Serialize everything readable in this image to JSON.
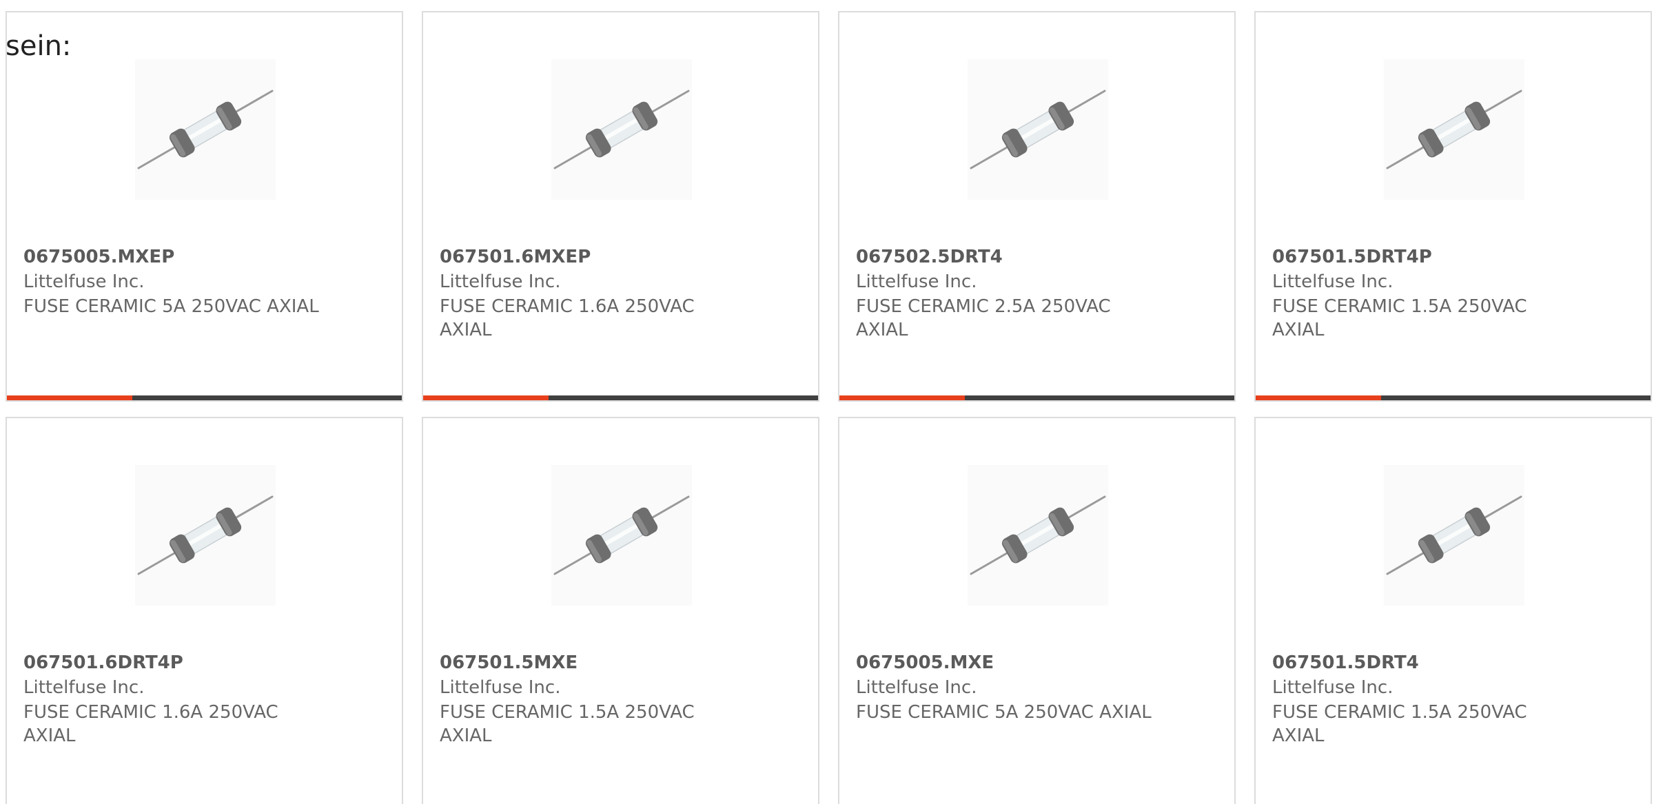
{
  "intro_text": "sein:",
  "colors": {
    "accent": "#e8401c",
    "bar": "#404040",
    "card_border": "#dcdcdc",
    "text": "#666666"
  },
  "products": [
    {
      "part": "0675005.MXEP",
      "manufacturer": "Littelfuse Inc.",
      "description": "FUSE CERAMIC 5A 250VAC AXIAL",
      "image_icon": "axial-fuse-image"
    },
    {
      "part": "067501.6MXEP",
      "manufacturer": "Littelfuse Inc.",
      "description": "FUSE CERAMIC 1.6A 250VAC AXIAL",
      "image_icon": "axial-fuse-image"
    },
    {
      "part": "067502.5DRT4",
      "manufacturer": "Littelfuse Inc.",
      "description": "FUSE CERAMIC 2.5A 250VAC AXIAL",
      "image_icon": "axial-fuse-image"
    },
    {
      "part": "067501.5DRT4P",
      "manufacturer": "Littelfuse Inc.",
      "description": "FUSE CERAMIC 1.5A 250VAC AXIAL",
      "image_icon": "axial-fuse-image"
    },
    {
      "part": "067501.6DRT4P",
      "manufacturer": "Littelfuse Inc.",
      "description": "FUSE CERAMIC 1.6A 250VAC AXIAL",
      "image_icon": "axial-fuse-image"
    },
    {
      "part": "067501.5MXE",
      "manufacturer": "Littelfuse Inc.",
      "description": "FUSE CERAMIC 1.5A 250VAC AXIAL",
      "image_icon": "axial-fuse-image"
    },
    {
      "part": "0675005.MXE",
      "manufacturer": "Littelfuse Inc.",
      "description": "FUSE CERAMIC 5A 250VAC AXIAL",
      "image_icon": "axial-fuse-image"
    },
    {
      "part": "067501.5DRT4",
      "manufacturer": "Littelfuse Inc.",
      "description": "FUSE CERAMIC 1.5A 250VAC AXIAL",
      "image_icon": "axial-fuse-image"
    }
  ]
}
